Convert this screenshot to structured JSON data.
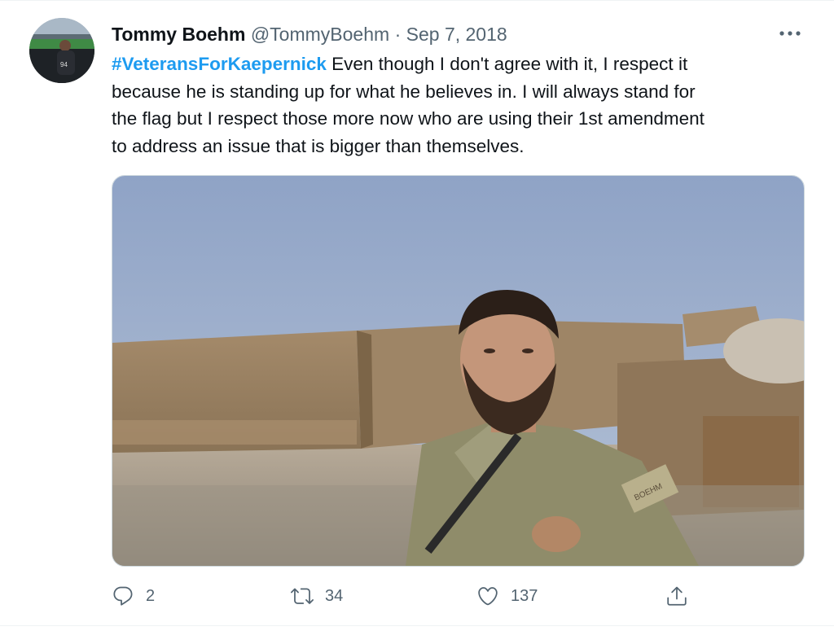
{
  "tweet": {
    "author": {
      "name": "Tommy Boehm",
      "handle": "@TommyBoehm",
      "separator": "·",
      "date": "Sep 7, 2018",
      "avatar_icon": "avatar-photo"
    },
    "more_icon": "more-horizontal-icon",
    "text": {
      "hashtag": "#VeteransForKaepernick",
      "line1": " Even though I don't agree with it, I respect it",
      "line2": "because he is standing up for what he believes in. I will always stand for",
      "line3": "the flag but I respect those more now who are using their 1st amendment",
      "line4": "to address an issue that is bigger than themselves."
    },
    "media": {
      "kind": "photo",
      "patch_text": "BOEHM"
    },
    "actions": {
      "reply": {
        "icon": "reply-icon",
        "count": "2"
      },
      "retweet": {
        "icon": "retweet-icon",
        "count": "34"
      },
      "like": {
        "icon": "heart-icon",
        "count": "137"
      },
      "share": {
        "icon": "share-icon"
      }
    },
    "colors": {
      "hashtag": "#1d9bf0",
      "secondary_text": "#536471",
      "primary_text": "#0f1419"
    }
  }
}
